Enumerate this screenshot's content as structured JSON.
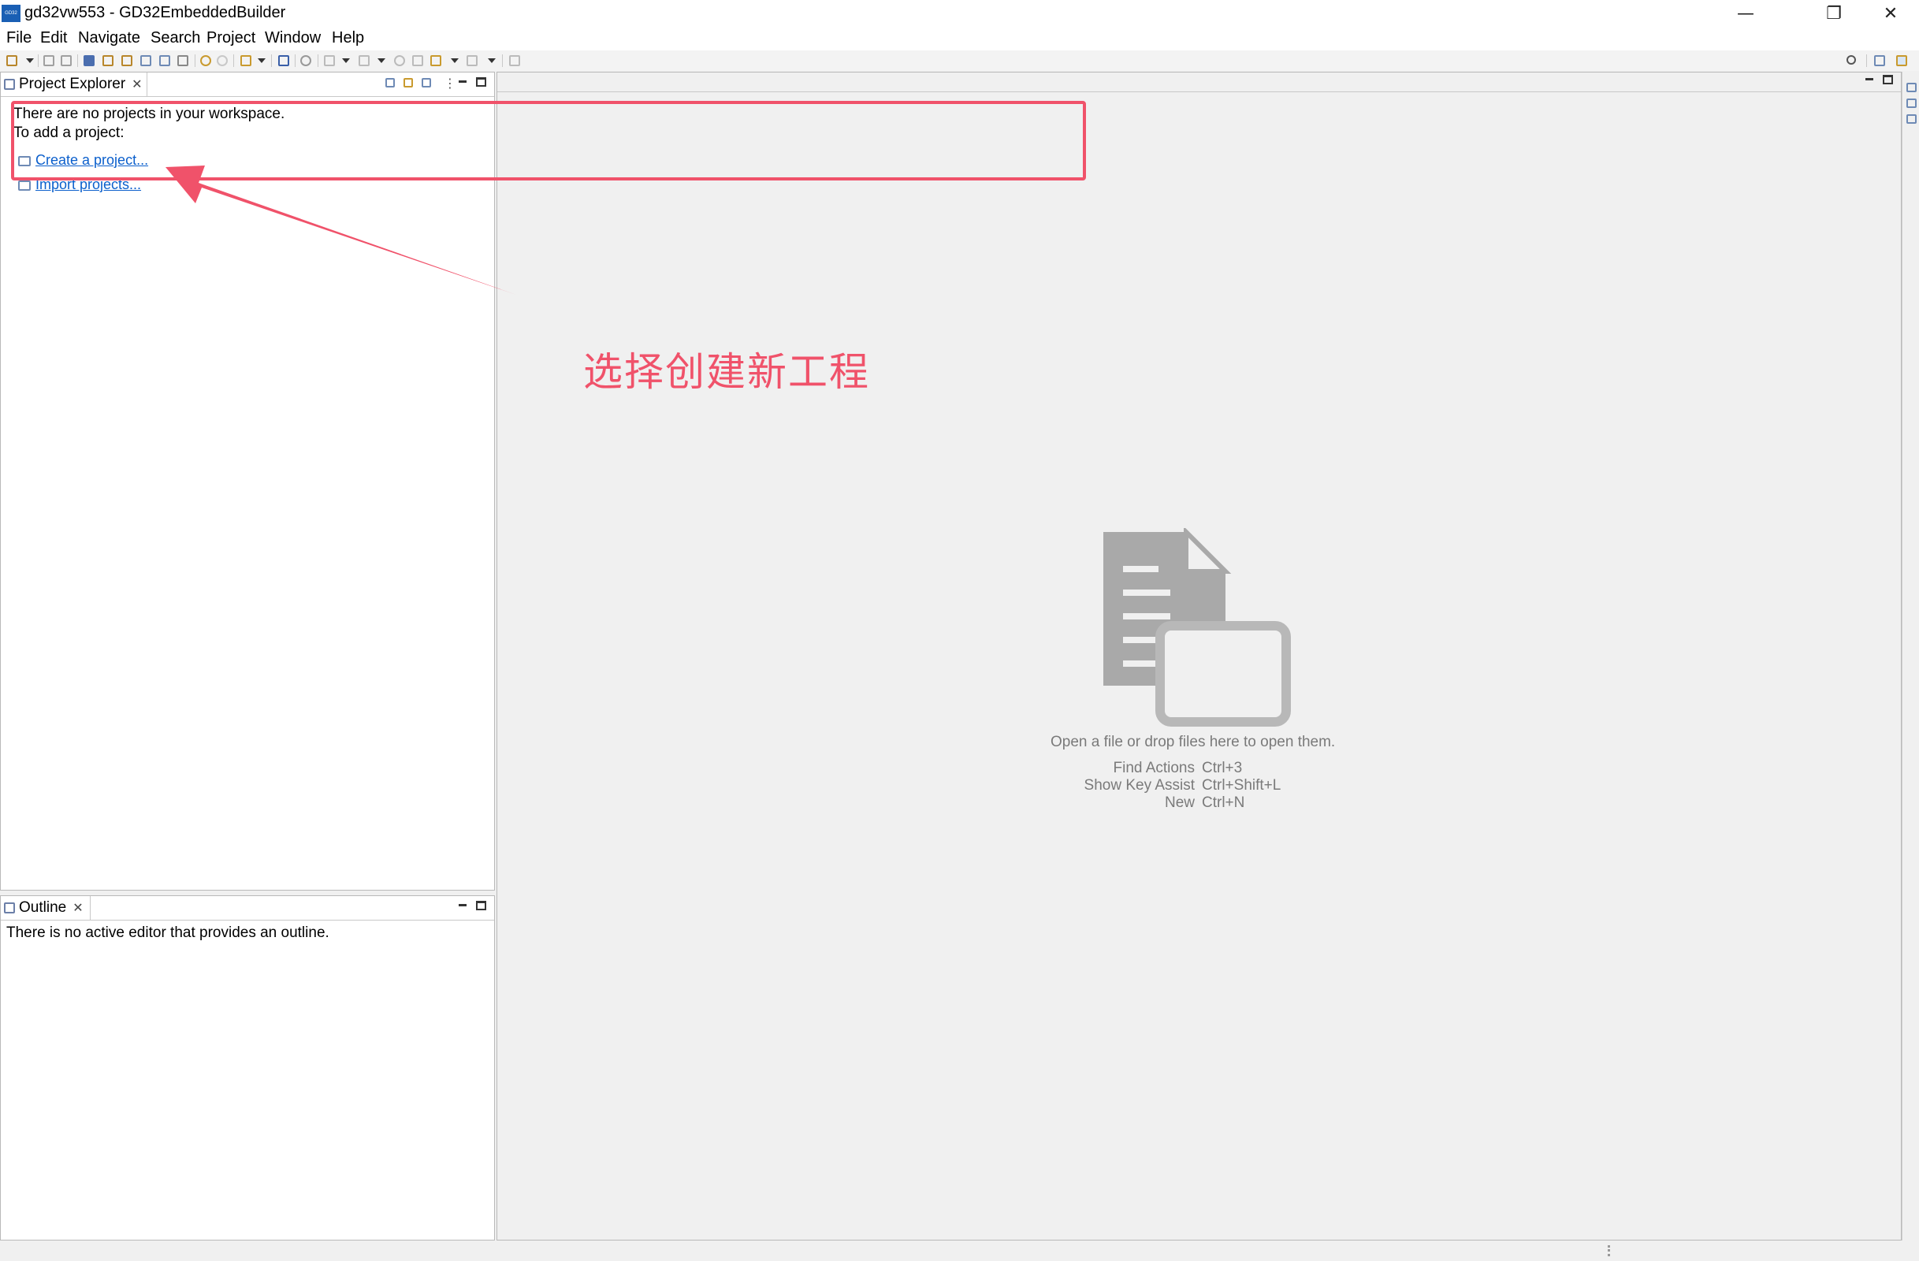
{
  "window": {
    "title": "gd32vw553 - GD32EmbeddedBuilder",
    "logo_text": "GD32",
    "controls": {
      "minimize": "—",
      "restore": "❐",
      "close": "✕"
    }
  },
  "menu": {
    "items": [
      "File",
      "Edit",
      "Navigate",
      "Search",
      "Project",
      "Window",
      "Help"
    ]
  },
  "project_explorer": {
    "tab_label": "Project Explorer",
    "line1": "There are no projects in your workspace.",
    "line2": "To add a project:",
    "create_link": "Create a project...",
    "import_link": "Import projects..."
  },
  "outline": {
    "tab_label": "Outline",
    "message": "There is no active editor that provides an outline."
  },
  "editor": {
    "hint": "Open a file or drop files here to open them.",
    "key_assist": [
      {
        "label": "Find Actions",
        "keys": "Ctrl+3"
      },
      {
        "label": "Show Key Assist",
        "keys": "Ctrl+Shift+L"
      },
      {
        "label": "New",
        "keys": "Ctrl+N"
      }
    ]
  },
  "annotation": {
    "text": "选择创建新工程",
    "color": "#f0526a"
  },
  "colors": {
    "accent_link": "#0b5fcc",
    "annotation": "#f0526a",
    "hint_gray": "#7a7a7a",
    "art_gray": "#a9a9a9"
  }
}
